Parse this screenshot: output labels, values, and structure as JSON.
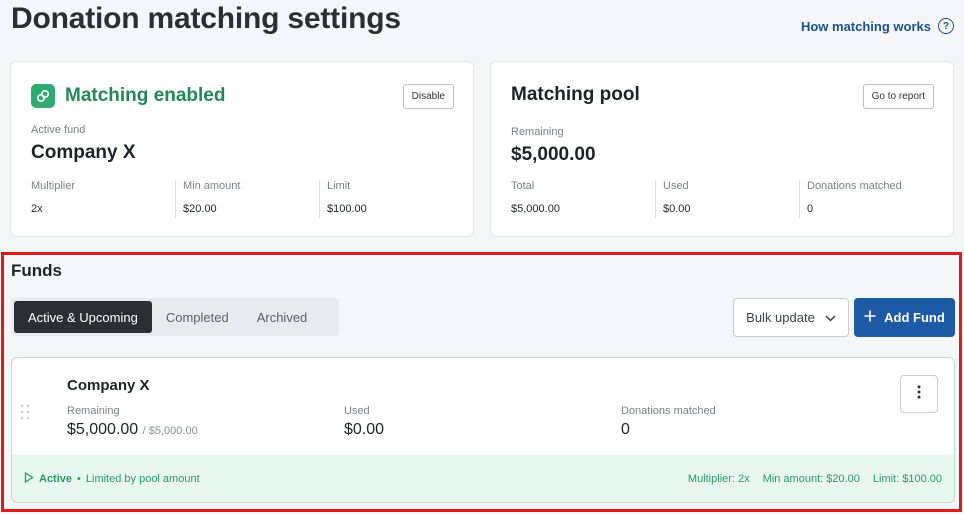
{
  "header": {
    "title": "Donation matching settings",
    "help_link": "How matching works"
  },
  "matching_card": {
    "status": "Matching enabled",
    "disable_label": "Disable",
    "active_fund_label": "Active fund",
    "active_fund_value": "Company X",
    "stats": [
      {
        "label": "Multiplier",
        "value": "2x"
      },
      {
        "label": "Min amount",
        "value": "$20.00"
      },
      {
        "label": "Limit",
        "value": "$100.00"
      }
    ]
  },
  "pool_card": {
    "title": "Matching pool",
    "report_label": "Go to report",
    "remaining_label": "Remaining",
    "remaining_value": "$5,000.00",
    "stats": [
      {
        "label": "Total",
        "value": "$5,000.00"
      },
      {
        "label": "Used",
        "value": "$0.00"
      },
      {
        "label": "Donations matched",
        "value": "0"
      }
    ]
  },
  "funds": {
    "title": "Funds",
    "tabs": [
      {
        "label": "Active & Upcoming",
        "active": true
      },
      {
        "label": "Completed",
        "active": false
      },
      {
        "label": "Archived",
        "active": false
      }
    ],
    "bulk_label": "Bulk update",
    "add_label": "Add Fund",
    "items": [
      {
        "name": "Company X",
        "remaining_label": "Remaining",
        "remaining_value": "$5,000.00",
        "remaining_total": "/ $5,000.00",
        "used_label": "Used",
        "used_value": "$0.00",
        "matched_label": "Donations matched",
        "matched_value": "0",
        "status": "Active",
        "status_note": "Limited by pool amount",
        "multiplier": "Multiplier: 2x",
        "min_amount": "Min amount: $20.00",
        "limit": "Limit: $100.00"
      }
    ]
  },
  "colors": {
    "accent_green": "#22875a",
    "primary_blue": "#1d5aa6",
    "highlight_red": "#e01919"
  }
}
